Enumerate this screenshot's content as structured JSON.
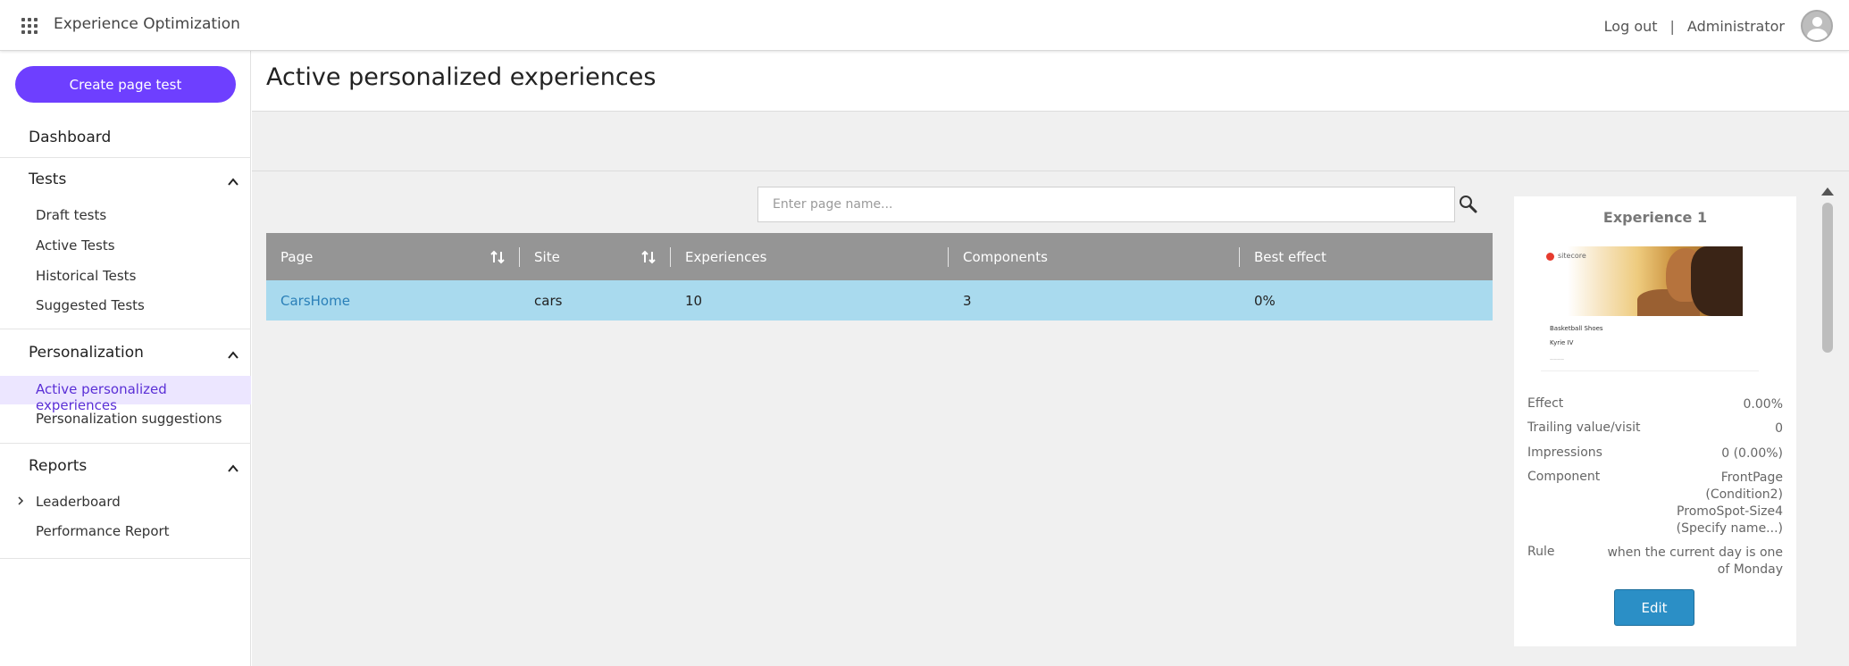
{
  "app": {
    "title": "Experience Optimization"
  },
  "header": {
    "logout": "Log out",
    "separator": "|",
    "user": "Administrator"
  },
  "sidebar": {
    "create_button": "Create page test",
    "dashboard": "Dashboard",
    "tests": {
      "title": "Tests",
      "items": [
        "Draft tests",
        "Active Tests",
        "Historical Tests",
        "Suggested Tests"
      ]
    },
    "personalization": {
      "title": "Personalization",
      "items": [
        "Active personalized experiences",
        "Personalization suggestions"
      ]
    },
    "reports": {
      "title": "Reports",
      "items": [
        "Leaderboard",
        "Performance Report"
      ]
    }
  },
  "page": {
    "title": "Active personalized experiences"
  },
  "search": {
    "placeholder": "Enter page name..."
  },
  "grid": {
    "columns": [
      "Page",
      "Site",
      "Experiences",
      "Components",
      "Best effect"
    ],
    "rows": [
      {
        "page": "CarsHome",
        "site": "cars",
        "experiences": "10",
        "components": "3",
        "best_effect": "0%"
      }
    ]
  },
  "experience_card": {
    "title": "Experience 1",
    "thumbnail": {
      "logo": "sitecore",
      "line1": "Basketball Shoes",
      "line2": "Kyrie IV",
      "line3": "————"
    },
    "props": {
      "effect_label": "Effect",
      "effect": "0.00%",
      "trailing_label": "Trailing value/visit",
      "trailing": "0",
      "impressions_label": "Impressions",
      "impressions": "0 (0.00%)",
      "component_label": "Component",
      "component_1": "FrontPage",
      "component_2": "(Condition2)",
      "component_3": "PromoSpot-Size4",
      "component_4": "(Specify name...)",
      "rule_label": "Rule",
      "rule_1": "when the current day is one",
      "rule_2": "of Monday"
    },
    "edit_button": "Edit"
  },
  "colors": {
    "accent": "#6e3fff",
    "row_selected": "#a9daee",
    "grid_header": "#959595",
    "edit_button": "#2b8fc6"
  }
}
